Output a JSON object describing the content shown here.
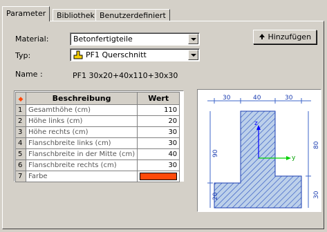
{
  "tabs": [
    {
      "label": "Parameter",
      "active": true
    },
    {
      "label": "Bibliothek",
      "active": false
    },
    {
      "label": "Benutzerdefiniert",
      "active": false
    }
  ],
  "form": {
    "material_label": "Material:",
    "material_value": "Betonfertigteile",
    "typ_label": "Typ:",
    "typ_value": "PF1 Querschnitt",
    "name_label": "Name :",
    "name_value": "PF1 30x20+40x110+30x30"
  },
  "add_button": {
    "label": "Hinzufügen",
    "icon": "arrow-up-icon"
  },
  "table": {
    "headers": {
      "col1": "Beschreibung",
      "col2": "Wert"
    },
    "rows": [
      {
        "n": "1",
        "desc": "Gesamthöhe (cm)",
        "val": "110"
      },
      {
        "n": "2",
        "desc": "Höhe links (cm)",
        "val": "20"
      },
      {
        "n": "3",
        "desc": "Höhe rechts (cm)",
        "val": "30"
      },
      {
        "n": "4",
        "desc": "Flanschbreite links (cm)",
        "val": "30"
      },
      {
        "n": "5",
        "desc": "Flanschbreite in der Mitte (cm)",
        "val": "40"
      },
      {
        "n": "6",
        "desc": "Flanschbreite rechts (cm)",
        "val": "30"
      },
      {
        "n": "7",
        "desc": "Farbe",
        "val": ""
      }
    ],
    "color_value": "#ff4a0a"
  },
  "preview": {
    "dim_top_left": "30",
    "dim_top_mid": "40",
    "dim_top_right": "30",
    "dim_left_height": "90",
    "dim_left_flange": "20",
    "dim_right_height": "80",
    "dim_right_flange": "30",
    "axis_z": "z",
    "axis_y": "y"
  }
}
